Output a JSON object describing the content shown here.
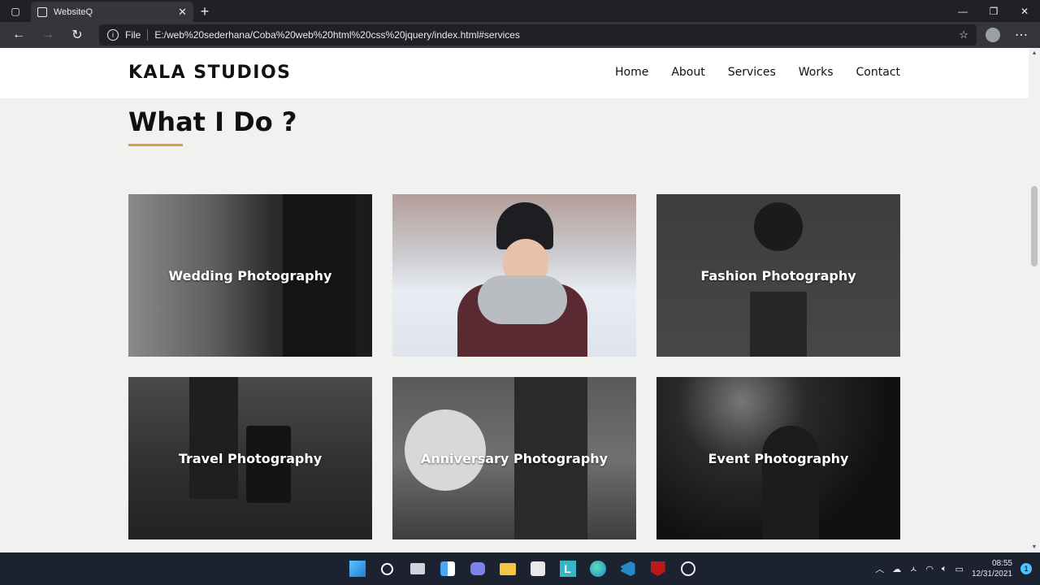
{
  "browser": {
    "tab_title": "WebsiteQ",
    "tab_close": "✕",
    "new_tab": "+",
    "omnibox_scheme": "File",
    "url": "E:/web%20sederhana/Coba%20web%20html%20css%20jquery/index.html#services"
  },
  "site": {
    "brand": "KALA STUDIOS",
    "menu": [
      "Home",
      "About",
      "Services",
      "Works",
      "Contact"
    ],
    "section_title": "What I Do ?",
    "cards": [
      {
        "caption": "Wedding Photography"
      },
      {
        "caption": ""
      },
      {
        "caption": "Fashion Photography"
      },
      {
        "caption": "Travel Photography"
      },
      {
        "caption": "Anniversary Photography"
      },
      {
        "caption": "Event Photography"
      }
    ]
  },
  "taskbar": {
    "time": "08:55",
    "date": "12/31/2021",
    "notification_count": "1",
    "apps": [
      "windows-start-icon",
      "search-icon",
      "task-view-icon",
      "widgets-icon",
      "teams-chat-icon",
      "file-explorer-icon",
      "store-icon",
      "l-app-icon",
      "edge-icon",
      "vscode-icon",
      "mcafee-icon",
      "obs-icon"
    ]
  },
  "colors": {
    "accent_underline": "#d4a13a",
    "page_background": "#f1f1ef"
  }
}
